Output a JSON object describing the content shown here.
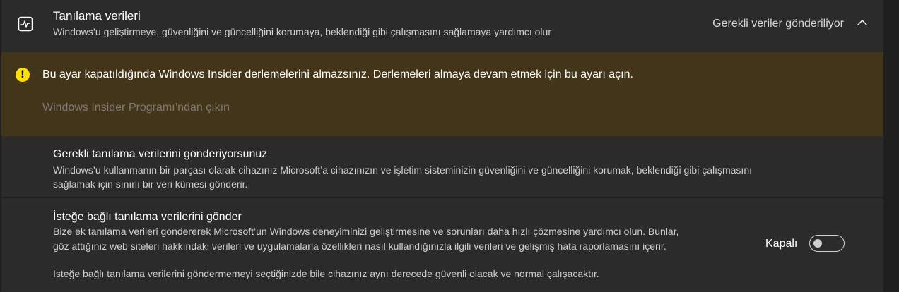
{
  "header": {
    "title": "Tanılama verileri",
    "subtitle": "Windows’u geliştirmeye, güvenliğini ve güncelliğini korumaya, beklendiği gibi çalışmasını sağlamaya yardımcı olur",
    "status": "Gerekli veriler gönderiliyor",
    "icon": "diagnostics-pulse-icon",
    "expand_icon": "chevron-up-icon"
  },
  "warning": {
    "icon": "warning-icon",
    "message": "Bu ayar kapatıldığında Windows Insider derlemelerini almazsınız. Derlemeleri almaya devam etmek için bu ayarı açın.",
    "link": "Windows Insider Programı’ndan çıkın"
  },
  "required": {
    "title": "Gerekli tanılama verilerini gönderiyorsunuz",
    "desc_line1": "Windows’u kullanmanın bir parçası olarak cihazınız Microsoft’a cihazınızın ve işletim sisteminizin güvenliğini ve güncelliğini korumak, beklendiği gibi çalışmasını",
    "desc_line2": "sağlamak için sınırlı bir veri kümesi gönderir."
  },
  "optional": {
    "title": "İsteğe bağlı tanılama verilerini gönder",
    "desc_line1": "Bize ek tanılama verileri göndererek Microsoft’un Windows deneyiminizi geliştirmesine ve sorunları daha hızlı çözmesine yardımcı olun. Bunlar,",
    "desc_line2": "göz attığınız web siteleri hakkındaki verileri ve uygulamalarla özellikleri nasıl kullandığınızla ilgili verileri ve gelişmiş hata raporlamasını içerir.",
    "note": "İsteğe bağlı tanılama verilerini göndermemeyi seçtiğinizde bile cihazınız aynı derecede güvenli olacak ve normal çalışacaktır.",
    "toggle_label": "Kapalı",
    "toggle_on": false
  }
}
